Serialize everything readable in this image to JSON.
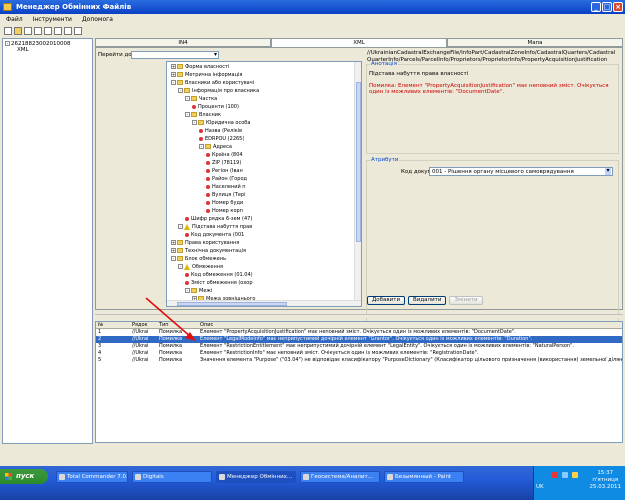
{
  "window": {
    "title": "Менеджер Обмінних Файлів"
  },
  "menu": [
    "Файл",
    "Інструменти",
    "Допомога"
  ],
  "left_tree": [
    "26218823002010008",
    "XML"
  ],
  "tabs": [
    "IN4",
    "XML",
    "Мапа"
  ],
  "goto_label": "Перейти до",
  "tree": [
    {
      "t": "Форма власності",
      "d": 5,
      "ex": "+",
      "ic": "fold"
    },
    {
      "t": "Метрична інформація",
      "d": 5,
      "ex": "+",
      "ic": "fold"
    },
    {
      "t": "Власники або користувачі",
      "d": 5,
      "ex": "-",
      "ic": "fold"
    },
    {
      "t": "Інформація про власника",
      "d": 6,
      "ex": "-",
      "ic": "fold"
    },
    {
      "t": "Частка",
      "d": 7,
      "ex": "-",
      "ic": "fold"
    },
    {
      "t": "Проценти (100)",
      "d": 8,
      "ex": "",
      "ic": "dot"
    },
    {
      "t": "Власник",
      "d": 7,
      "ex": "-",
      "ic": "fold"
    },
    {
      "t": "Юридична особа",
      "d": 8,
      "ex": "-",
      "ic": "fold"
    },
    {
      "t": "Назва (Реліків",
      "d": 9,
      "ex": "",
      "ic": "dot"
    },
    {
      "t": "EDRPOU (2265(",
      "d": 9,
      "ex": "",
      "ic": "dot"
    },
    {
      "t": "Адреса",
      "d": 9,
      "ex": "-",
      "ic": "fold"
    },
    {
      "t": "Країна (804",
      "d": 10,
      "ex": "",
      "ic": "dot"
    },
    {
      "t": "ZIP (78119)",
      "d": 10,
      "ex": "",
      "ic": "dot"
    },
    {
      "t": "Регіон (Іван",
      "d": 10,
      "ex": "",
      "ic": "dot"
    },
    {
      "t": "Район (Город",
      "d": 10,
      "ex": "",
      "ic": "dot"
    },
    {
      "t": "Населений п",
      "d": 10,
      "ex": "",
      "ic": "dot"
    },
    {
      "t": "Вулиця (Тері",
      "d": 10,
      "ex": "",
      "ic": "dot"
    },
    {
      "t": "Номер буди",
      "d": 10,
      "ex": "",
      "ic": "dot"
    },
    {
      "t": "Номер корп",
      "d": 10,
      "ex": "",
      "ic": "dot"
    },
    {
      "t": "Шифр рядка 6-зем (47)",
      "d": 7,
      "ex": "",
      "ic": "dot"
    },
    {
      "t": "Підстава набуття прав",
      "d": 6,
      "ex": "-",
      "ic": "warn"
    },
    {
      "t": "Код документа (001",
      "d": 7,
      "ex": "",
      "ic": "dot"
    },
    {
      "t": "Права користування",
      "d": 5,
      "ex": "+",
      "ic": "fold"
    },
    {
      "t": "Технічна документація",
      "d": 5,
      "ex": "+",
      "ic": "fold"
    },
    {
      "t": "Блок обмежень",
      "d": 5,
      "ex": "-",
      "ic": "fold"
    },
    {
      "t": "Обмеження",
      "d": 6,
      "ex": "-",
      "ic": "warn"
    },
    {
      "t": "Код обмеження (01.04)",
      "d": 7,
      "ex": "",
      "ic": "dot"
    },
    {
      "t": "Зміст обмеження (охор",
      "d": 7,
      "ex": "",
      "ic": "dot"
    },
    {
      "t": "Межі",
      "d": 7,
      "ex": "-",
      "ic": "fold"
    },
    {
      "t": "Межа зовнішнього",
      "d": 8,
      "ex": "+",
      "ic": "fold"
    }
  ],
  "path": "//UkrainianCadastralExchangeFile/InfoPart/CadastralZoneInfo/CadastralQuarters/CadastralQuarterInfo/Parcels/ParcelInfo/Proprietors/ProprietorInfo/PropertyAcquisitionJustification",
  "annotation": {
    "label": "Анотація",
    "text": "Підстава набуття права власності",
    "warning": "Помилка: Елемент \"PropertyAcquisitionJustification\" має неповний зміст. Очікується один із можливих елементів: \"DocumentDate\"."
  },
  "attributes": {
    "label": "Атрибути",
    "field_label": "Код документа",
    "field_value": "001 - Рішення органу місцевого самоврядування"
  },
  "buttons": [
    "Добавити",
    "Видалити",
    "Змінити"
  ],
  "grid": {
    "headers": [
      "№",
      "Рядок",
      "Тип",
      "Опис"
    ],
    "rows": [
      [
        "1",
        "//Ukrai",
        "Помилка",
        "Елемент \"PropertyAcquisitionJustification\" має неповний зміст. Очікується один із можливих елементів: \"DocumentDate\"."
      ],
      [
        "2",
        "//Ukrai",
        "Помилка",
        "Елемент \"LegalModeInfo\" має неприпустимий дочірній елемент \"Grantor\". Очікується один із можливих елементів: \"Duration\"."
      ],
      [
        "3",
        "//Ukrai",
        "Помилка",
        "Елемент \"RestrictionEntitlement\" має неприпустимий дочірній елемент \"LegalEntity\". Очікується один із можливих елементів: \"NaturalPerson\"."
      ],
      [
        "4",
        "//Ukrai",
        "Помилка",
        "Елемент \"RestrictionInfo\" має неповний зміст. Очікується один із можливих елементів: \"RegistrationDate\"."
      ],
      [
        "5",
        "//Ukrai",
        "Помилка",
        "Значення елемента \"Purpose\" (\"03.04\") не відповідає класифікатору \"PurposeDictionary\" (Класифікатор цільового призначення (використання) земельної ділян..."
      ]
    ],
    "selected_row": 2
  },
  "taskbar": {
    "start": "пуск",
    "items": [
      "Total Commander 7.0...",
      "Digitals",
      "Менеджер Обмінних...",
      "Геосистема/Аналит...",
      "Безымянный - Paint"
    ],
    "active": 2,
    "lang": "UK",
    "time": "15:37",
    "day": "п'ятниця",
    "date": "25.03.2011"
  }
}
